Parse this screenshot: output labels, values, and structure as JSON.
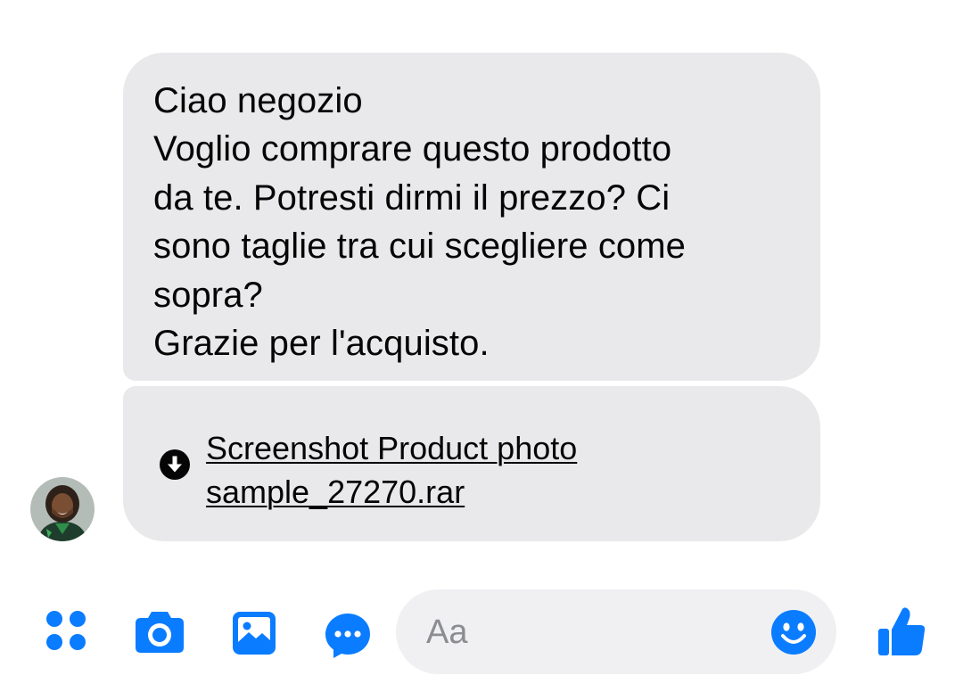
{
  "message": {
    "lines": [
      "Ciao negozio",
      "Voglio comprare questo prodotto",
      "da te. Potresti dirmi il prezzo? Ci",
      "sono taglie tra cui scegliere come",
      "sopra?",
      "Grazie per l'acquisto."
    ]
  },
  "attachment": {
    "icon": "download-icon",
    "name_lines": [
      "Screenshot Product photo",
      "sample_27270.rar"
    ]
  },
  "sender": {
    "avatar_icon": "avatar"
  },
  "composer": {
    "input_placeholder": "Aa",
    "icons": [
      "apps-icon",
      "camera-icon",
      "image-icon",
      "messenger-icon",
      "emoji-icon",
      "thumbs-up-icon"
    ]
  },
  "colors": {
    "accent": "#0a7cff",
    "bubble": "#e9e9eb",
    "input_background": "#f0f0f2",
    "placeholder": "#8b8d91"
  }
}
